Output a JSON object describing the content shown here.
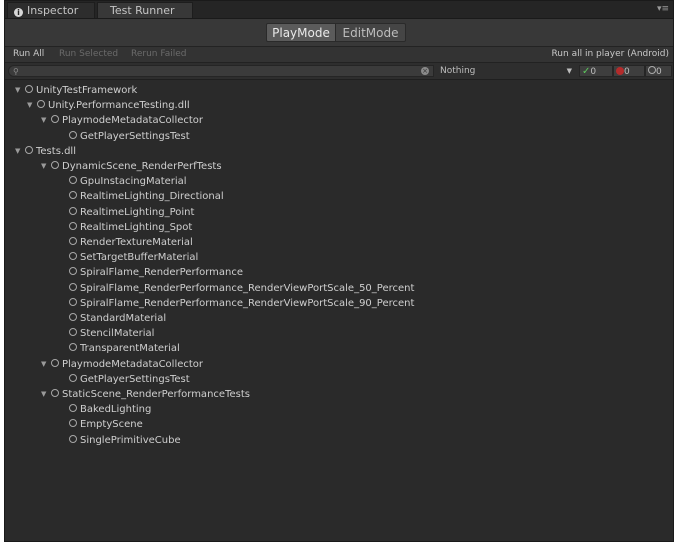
{
  "tabs": {
    "inspector": "Inspector",
    "test_runner": "Test Runner"
  },
  "modes": {
    "play": "PlayMode",
    "edit": "EditMode"
  },
  "toolbar": {
    "run_all": "Run All",
    "run_selected": "Run Selected",
    "rerun_failed": "Rerun Failed",
    "run_in_player": "Run all in player (Android)"
  },
  "search": {
    "value": "",
    "filter": "Nothing"
  },
  "counters": {
    "passed": "0",
    "failed": "0",
    "skipped": "0"
  },
  "tree": [
    {
      "label": "UnityTestFramework",
      "depth": 0,
      "expanded": true
    },
    {
      "label": "Unity.PerformanceTesting.dll",
      "depth": 1,
      "expanded": true
    },
    {
      "label": "PlaymodeMetadataCollector",
      "depth": 2,
      "expanded": true
    },
    {
      "label": "GetPlayerSettingsTest",
      "depth": 3
    },
    {
      "label": "Tests.dll",
      "depth": 0,
      "expanded": true
    },
    {
      "label": "DynamicScene_RenderPerfTests",
      "depth": 2,
      "expanded": true
    },
    {
      "label": "GpuInstacingMaterial",
      "depth": 3
    },
    {
      "label": "RealtimeLighting_Directional",
      "depth": 3
    },
    {
      "label": "RealtimeLighting_Point",
      "depth": 3
    },
    {
      "label": "RealtimeLighting_Spot",
      "depth": 3
    },
    {
      "label": "RenderTextureMaterial",
      "depth": 3
    },
    {
      "label": "SetTargetBufferMaterial",
      "depth": 3
    },
    {
      "label": "SpiralFlame_RenderPerformance",
      "depth": 3
    },
    {
      "label": "SpiralFlame_RenderPerformance_RenderViewPortScale_50_Percent",
      "depth": 3
    },
    {
      "label": "SpiralFlame_RenderPerformance_RenderViewPortScale_90_Percent",
      "depth": 3
    },
    {
      "label": "StandardMaterial",
      "depth": 3
    },
    {
      "label": "StencilMaterial",
      "depth": 3
    },
    {
      "label": "TransparentMaterial",
      "depth": 3
    },
    {
      "label": "PlaymodeMetadataCollector",
      "depth": 2,
      "expanded": true
    },
    {
      "label": "GetPlayerSettingsTest",
      "depth": 3
    },
    {
      "label": "StaticScene_RenderPerformanceTests",
      "depth": 2,
      "expanded": true
    },
    {
      "label": "BakedLighting",
      "depth": 3
    },
    {
      "label": "EmptyScene",
      "depth": 3
    },
    {
      "label": "SinglePrimitiveCube",
      "depth": 3
    }
  ]
}
